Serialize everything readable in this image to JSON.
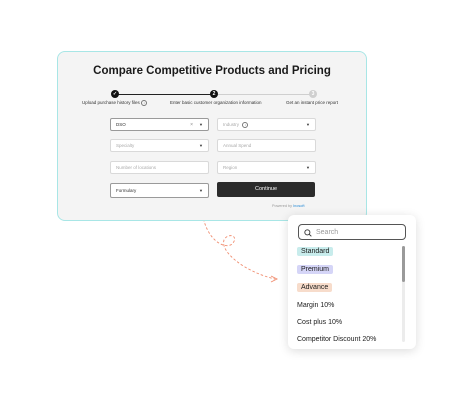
{
  "card": {
    "title": "Compare Competitive Products and Pricing",
    "steps": [
      {
        "label": "Upload purchase history files",
        "state": "done",
        "glyph": "✓"
      },
      {
        "label": "Enter basic customer organization information",
        "state": "active",
        "glyph": "2"
      },
      {
        "label": "Get an instant price report",
        "state": "pending",
        "glyph": "3"
      }
    ],
    "fields": {
      "dso": {
        "value": "DSO"
      },
      "right_top": {
        "placeholder": "Industry"
      },
      "specialty": {
        "placeholder": "Specialty"
      },
      "annual_spend": {
        "placeholder": "Annual Spend"
      },
      "locations": {
        "placeholder": "Number of locations"
      },
      "region": {
        "placeholder": "Region"
      },
      "formulary": {
        "placeholder": "Formulary"
      }
    },
    "continue_label": "Continue",
    "powered_prefix": "Powered by",
    "powered_brand": "Inosoft"
  },
  "dropdown": {
    "search_placeholder": "Search",
    "options": [
      {
        "label": "Standard",
        "tag_color": "#c8ecec"
      },
      {
        "label": "Premium",
        "tag_color": "#d5d5f7"
      },
      {
        "label": "Advance",
        "tag_color": "#f7dccb"
      },
      {
        "label": "Margin 10%"
      },
      {
        "label": "Cost plus 10%"
      },
      {
        "label": "Competitor Discount 20%"
      }
    ]
  },
  "colors": {
    "accent_border": "#a8e6e6",
    "button": "#2b2b2b",
    "arrow": "#f08b6d"
  }
}
